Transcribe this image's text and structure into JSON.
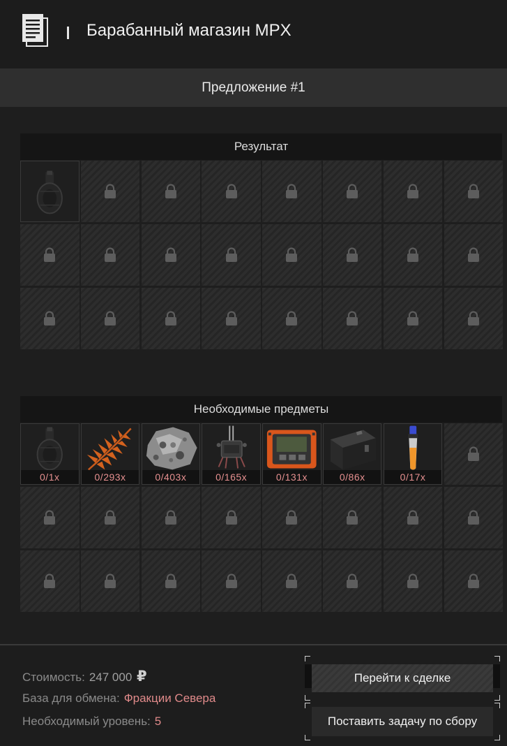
{
  "header": {
    "title": "Барабанный магазин MPX",
    "icon": "document-icon"
  },
  "offer": {
    "label": "Предложение #1"
  },
  "result": {
    "heading": "Результат",
    "item_icon": "drum-magazine-icon",
    "total_slots": 24
  },
  "required": {
    "heading": "Необходимые предметы",
    "items": [
      {
        "icon": "drum-magazine-icon",
        "quantity": "0/1x"
      },
      {
        "icon": "fern-leaf-icon",
        "quantity": "0/293x"
      },
      {
        "icon": "ore-rock-icon",
        "quantity": "0/403x"
      },
      {
        "icon": "electronic-component-icon",
        "quantity": "0/165x"
      },
      {
        "icon": "orange-device-icon",
        "quantity": "0/131x"
      },
      {
        "icon": "battery-block-icon",
        "quantity": "0/86x"
      },
      {
        "icon": "vial-icon",
        "quantity": "0/17x"
      }
    ],
    "total_slots": 24
  },
  "footer": {
    "cost_label": "Стоимость:",
    "cost_value": "247 000",
    "currency": "₽",
    "base_label": "База для обмена:",
    "base_value": "Фракции Севера",
    "level_label": "Необходимый уровень:",
    "level_value": "5"
  },
  "buttons": {
    "deal": "Перейти к сделке",
    "task": "Поставить задачу по сбору"
  },
  "colors": {
    "accent": "#e08a8a",
    "quantity": "#e69090",
    "background": "#1e1e1e"
  }
}
